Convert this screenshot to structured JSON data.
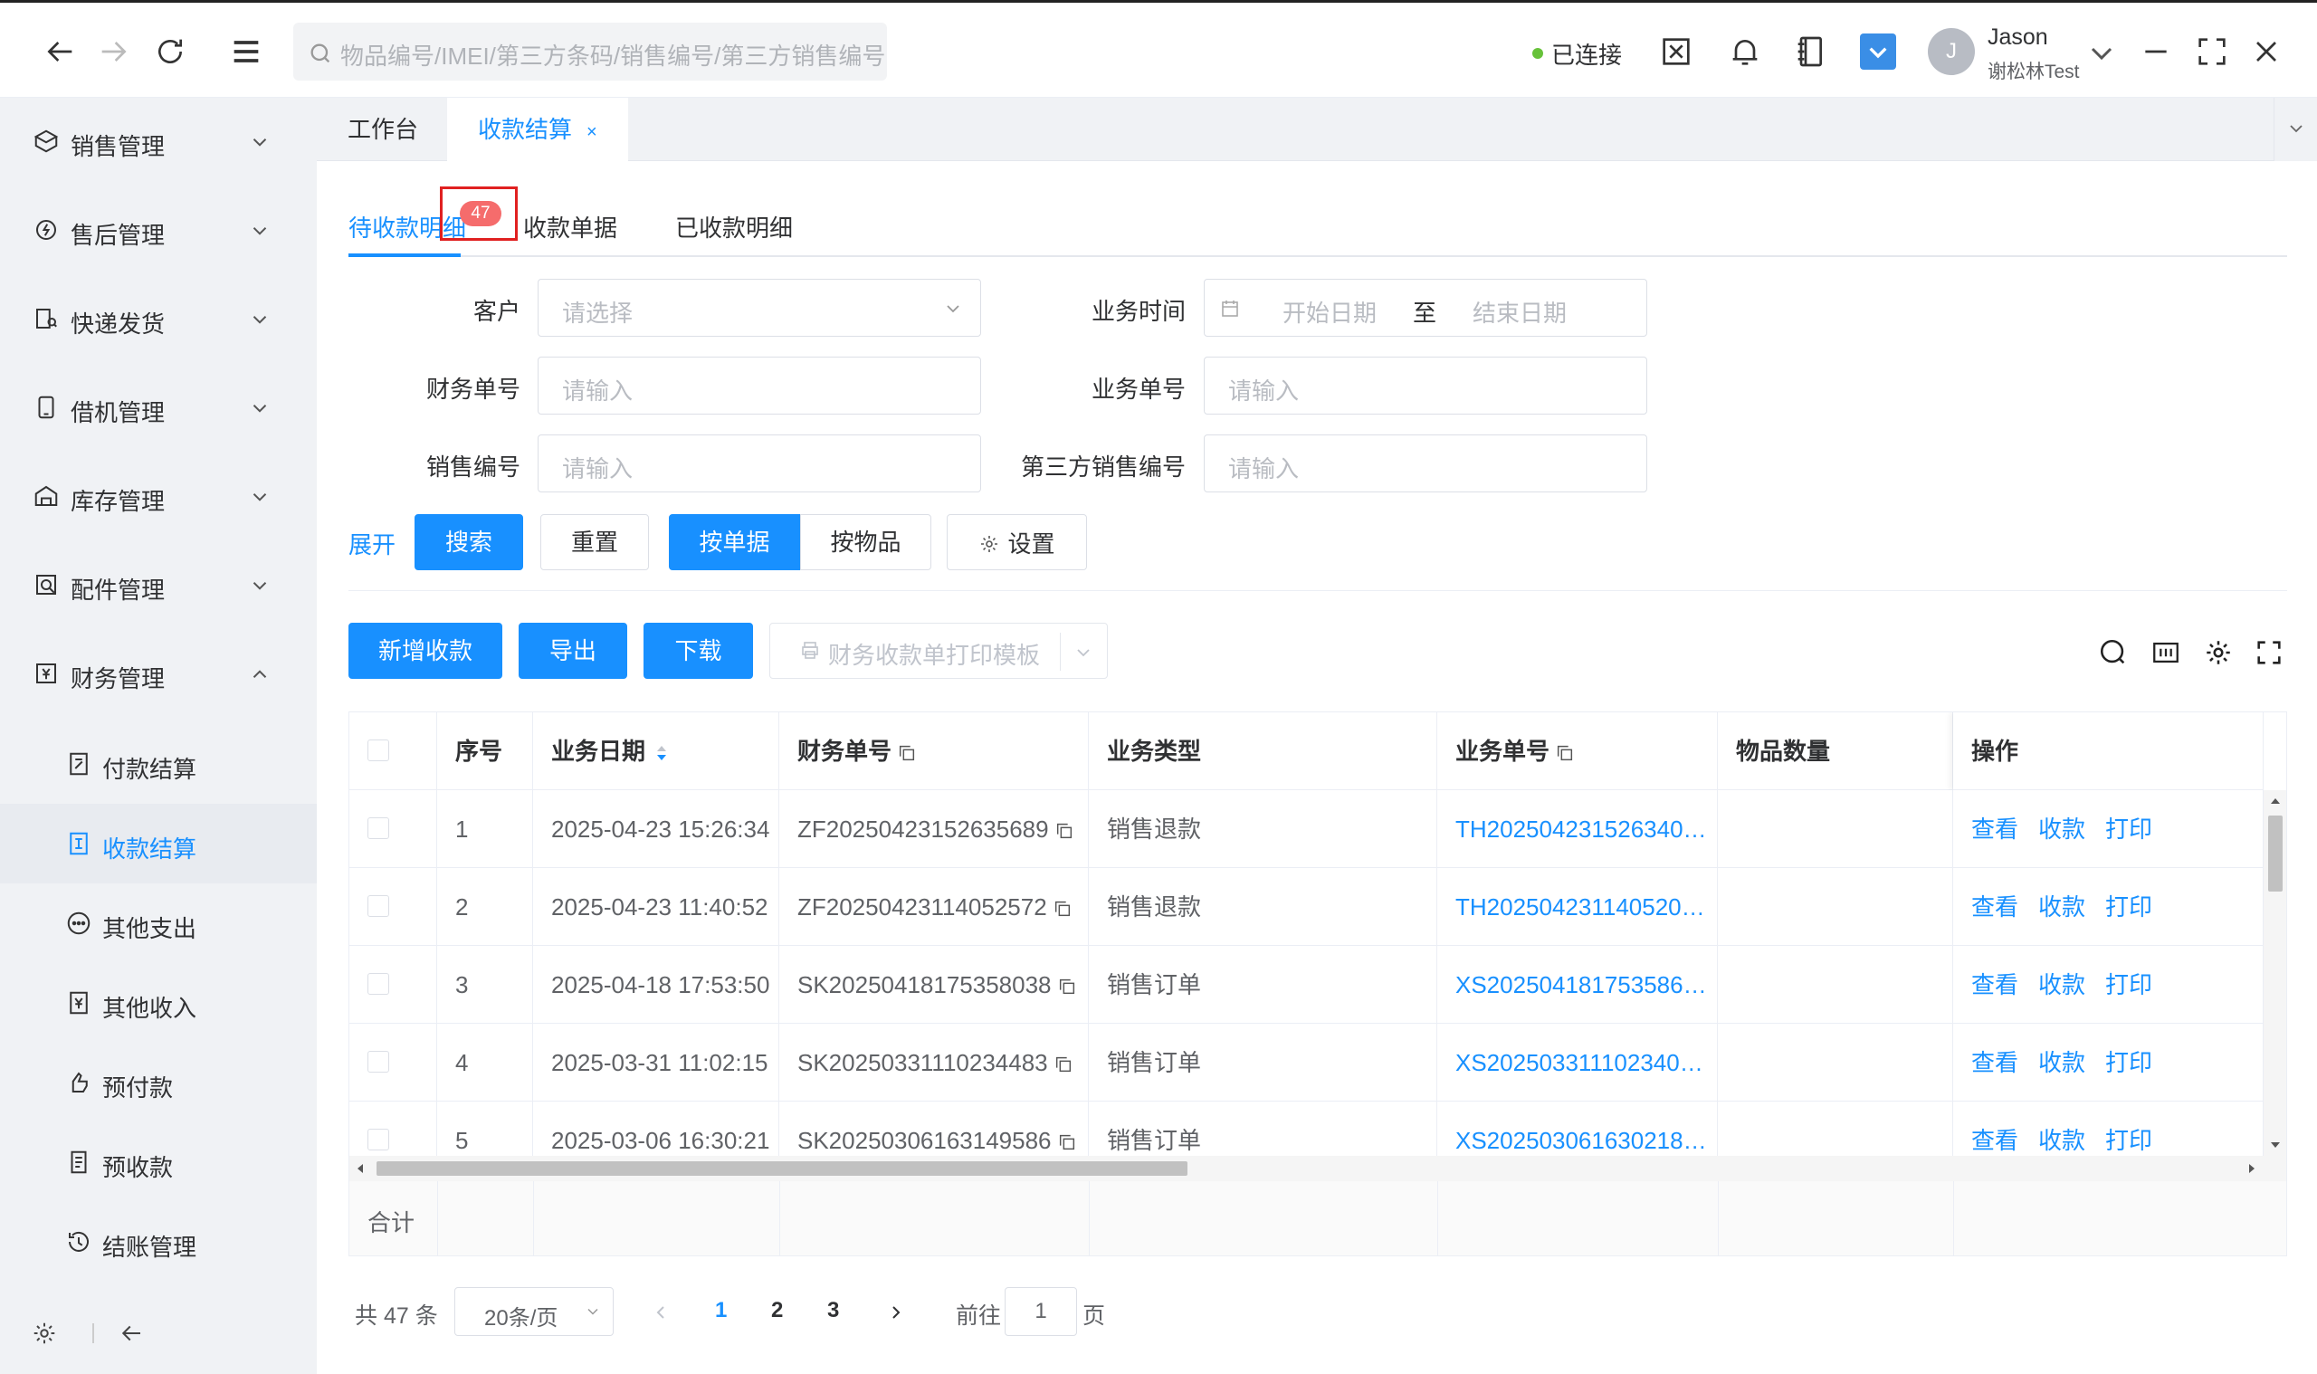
{
  "header": {
    "search_placeholder": "物品编号/IMEI/第三方条码/销售编号/第三方销售编号",
    "connection_status": "已连接",
    "user_name": "Jason",
    "user_sub": "谢松林Test",
    "avatar_letter": "J"
  },
  "sidebar": {
    "menus": [
      {
        "label": "销售管理",
        "icon": "sales-icon"
      },
      {
        "label": "售后管理",
        "icon": "after-sales-icon"
      },
      {
        "label": "快递发货",
        "icon": "delivery-icon"
      },
      {
        "label": "借机管理",
        "icon": "phone-icon"
      },
      {
        "label": "库存管理",
        "icon": "warehouse-icon"
      },
      {
        "label": "配件管理",
        "icon": "parts-icon"
      },
      {
        "label": "财务管理",
        "icon": "finance-icon"
      }
    ],
    "finance_children": [
      {
        "label": "付款结算",
        "icon": "payment-icon"
      },
      {
        "label": "收款结算",
        "icon": "receipt-icon"
      },
      {
        "label": "其他支出",
        "icon": "other-expense-icon"
      },
      {
        "label": "其他收入",
        "icon": "other-income-icon"
      },
      {
        "label": "预付款",
        "icon": "prepay-icon"
      },
      {
        "label": "预收款",
        "icon": "prereceive-icon"
      },
      {
        "label": "结账管理",
        "icon": "history-icon"
      }
    ]
  },
  "tabs": {
    "workbench": "工作台",
    "current": "收款结算",
    "close": "×"
  },
  "subtabs": {
    "pending": "待收款明细",
    "badge": "47",
    "receipts": "收款单据",
    "received": "已收款明细"
  },
  "form": {
    "customer_label": "客户",
    "customer_placeholder": "请选择",
    "biz_time_label": "业务时间",
    "start_date": "开始日期",
    "to": "至",
    "end_date": "结束日期",
    "finance_no_label": "财务单号",
    "finance_no_placeholder": "请输入",
    "biz_no_label": "业务单号",
    "biz_no_placeholder": "请输入",
    "sales_no_label": "销售编号",
    "sales_no_placeholder": "请输入",
    "third_sales_no_label": "第三方销售编号",
    "third_sales_no_placeholder": "请输入"
  },
  "buttons": {
    "expand": "展开",
    "search": "搜索",
    "reset": "重置",
    "by_doc": "按单据",
    "by_item": "按物品",
    "settings": "设置",
    "add_receipt": "新增收款",
    "export": "导出",
    "download": "下载",
    "print_template": "财务收款单打印模板"
  },
  "table": {
    "headers": [
      "序号",
      "业务日期",
      "财务单号",
      "业务类型",
      "业务单号",
      "物品数量",
      "操作"
    ],
    "rows": [
      {
        "no": "1",
        "date": "2025-04-23 15:26:34",
        "fin_no": "ZF20250423152635689",
        "type": "销售退款",
        "biz_no": "TH202504231526340…",
        "qty": ""
      },
      {
        "no": "2",
        "date": "2025-04-23 11:40:52",
        "fin_no": "ZF20250423114052572",
        "type": "销售退款",
        "biz_no": "TH202504231140520…",
        "qty": ""
      },
      {
        "no": "3",
        "date": "2025-04-18 17:53:50",
        "fin_no": "SK20250418175358038",
        "type": "销售订单",
        "biz_no": "XS202504181753586…",
        "qty": ""
      },
      {
        "no": "4",
        "date": "2025-03-31 11:02:15",
        "fin_no": "SK20250331110234483",
        "type": "销售订单",
        "biz_no": "XS202503311102340…",
        "qty": ""
      },
      {
        "no": "5",
        "date": "2025-03-06 16:30:21",
        "fin_no": "SK20250306163149586",
        "type": "销售订单",
        "biz_no": "XS202503061630218…",
        "qty": ""
      }
    ],
    "ops": [
      "查看",
      "收款",
      "打印"
    ],
    "sum_label": "合计"
  },
  "pagination": {
    "total": "共 47 条",
    "page_size": "20条/页",
    "pages": [
      "1",
      "2",
      "3"
    ],
    "goto": "前往",
    "goto_value": "1",
    "page_suffix": "页"
  },
  "colors": {
    "primary": "#1890ff",
    "badge": "#f56c6c",
    "connected": "#67c23a"
  }
}
